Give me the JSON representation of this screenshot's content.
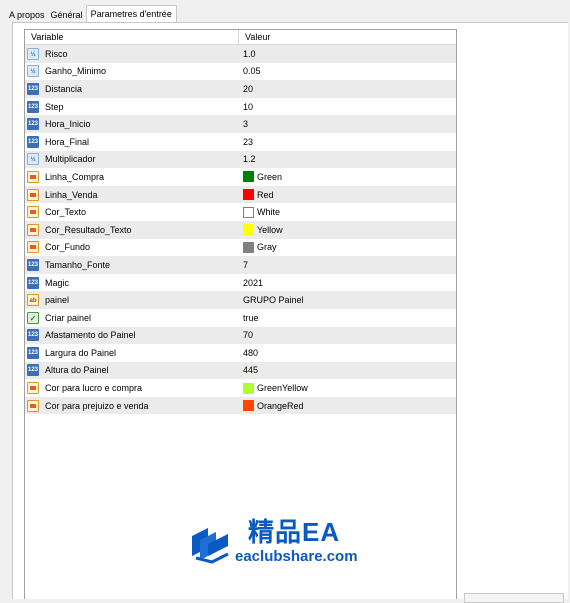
{
  "tabs": [
    {
      "label": "A propos"
    },
    {
      "label": "Général"
    },
    {
      "label": "Parametres d'entrée"
    }
  ],
  "table": {
    "headers": {
      "variable": "Variable",
      "value": "Valeur"
    },
    "rows": [
      {
        "name": "Risco",
        "value": "1.0",
        "type_icon": "double-icon"
      },
      {
        "name": "Ganho_Minimo",
        "value": "0.05",
        "type_icon": "double-icon"
      },
      {
        "name": "Distancia",
        "value": "20",
        "type_icon": "integer-icon"
      },
      {
        "name": "Step",
        "value": "10",
        "type_icon": "integer-icon"
      },
      {
        "name": "Hora_Inicio",
        "value": "3",
        "type_icon": "integer-icon"
      },
      {
        "name": "Hora_Final",
        "value": "23",
        "type_icon": "integer-icon"
      },
      {
        "name": "Multiplicador",
        "value": "1.2",
        "type_icon": "double-icon"
      },
      {
        "name": "Linha_Compra",
        "value": "Green",
        "type_icon": "color-icon",
        "swatch": "#008000"
      },
      {
        "name": "Linha_Venda",
        "value": "Red",
        "type_icon": "color-icon",
        "swatch": "#ff0000"
      },
      {
        "name": "Cor_Texto",
        "value": "White",
        "type_icon": "color-icon",
        "swatch": "#ffffff"
      },
      {
        "name": "Cor_Resultado_Texto",
        "value": "Yellow",
        "type_icon": "color-icon",
        "swatch": "#ffff00"
      },
      {
        "name": "Cor_Fundo",
        "value": "Gray",
        "type_icon": "color-icon",
        "swatch": "#808080"
      },
      {
        "name": "Tamanho_Fonte",
        "value": "7",
        "type_icon": "integer-icon"
      },
      {
        "name": "Magic",
        "value": "2021",
        "type_icon": "integer-icon"
      },
      {
        "name": "painel",
        "value": "GRUPO Painel",
        "type_icon": "string-icon"
      },
      {
        "name": "Criar painel",
        "value": "true",
        "type_icon": "bool-icon"
      },
      {
        "name": "Afastamento do Painel",
        "value": "70",
        "type_icon": "integer-icon"
      },
      {
        "name": "Largura do Painel",
        "value": "480",
        "type_icon": "integer-icon"
      },
      {
        "name": "Altura do Painel",
        "value": "445",
        "type_icon": "integer-icon"
      },
      {
        "name": "Cor para lucro e compra",
        "value": "GreenYellow",
        "type_icon": "color-icon",
        "swatch": "#adff2f"
      },
      {
        "name": "Cor para prejuizo e venda",
        "value": "OrangeRed",
        "type_icon": "color-icon",
        "swatch": "#ff4500"
      }
    ]
  },
  "watermark": {
    "title": "精品EA",
    "url": "eaclubshare.com",
    "color": "#0b5ac2"
  },
  "colors": {
    "alt_row": "#ebebeb",
    "grid_border": "#a0a0a0"
  }
}
